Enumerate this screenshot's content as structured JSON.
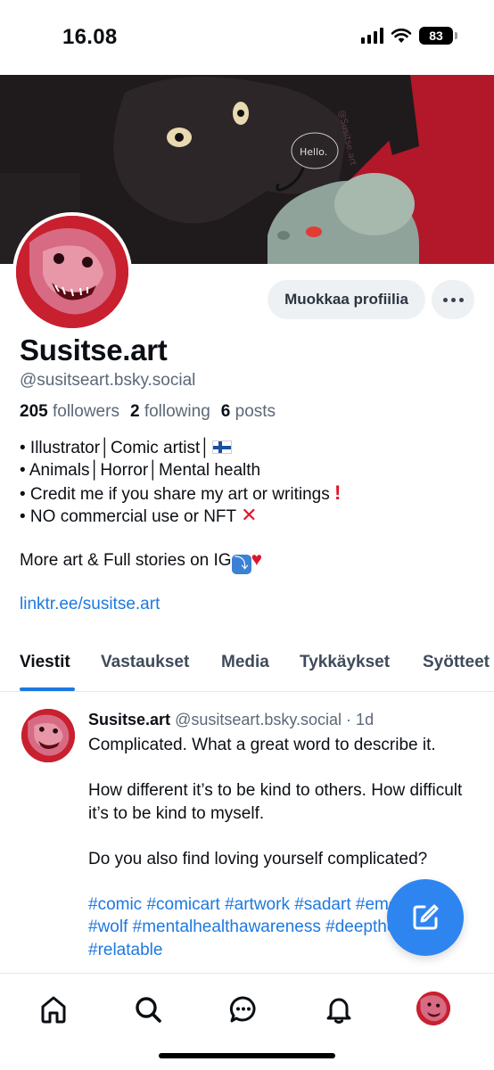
{
  "status_bar": {
    "time": "16.08",
    "battery": "83"
  },
  "banner": {
    "speech_text": "Hello.",
    "watermark": "@Susitse.art"
  },
  "profile": {
    "edit_label": "Muokkaa profiilia",
    "display_name": "Susitse.art",
    "handle": "@susitseart.bsky.social",
    "followers_count": "205",
    "followers_label": "followers",
    "following_count": "2",
    "following_label": "following",
    "posts_count": "6",
    "posts_label": "posts",
    "bio": {
      "line1": "• Illustrator│Comic artist│",
      "line2": "• Animals│Horror│Mental health",
      "line3": "• Credit me if you share my art or writings ",
      "line4": "• NO commercial use or NFT ",
      "more": "More art & Full stories on IG",
      "link": "linktr.ee/susitse.art"
    }
  },
  "tabs": [
    "Viestit",
    "Vastaukset",
    "Media",
    "Tykkäykset",
    "Syötteet"
  ],
  "post": {
    "author": "Susitse.art",
    "handle_time": "@susitseart.bsky.social · 1d",
    "p1": "Complicated. What a great word to describe it.",
    "p2": "How different it’s to be kind to others. How difficult it’s to be kind to myself.",
    "p3": "Do you also find loving yourself complicated?",
    "tags": "#comic #comicart #artwork #sadart #emotional #wolf #mentalhealthawareness #deepthoughts #relatable"
  },
  "nav": [
    "home-icon",
    "search-icon",
    "chat-icon",
    "bell-icon",
    "profile-avatar"
  ],
  "colors": {
    "accent": "#1d79e0",
    "banner_red": "#b3172a",
    "fab": "#2f85f0"
  }
}
